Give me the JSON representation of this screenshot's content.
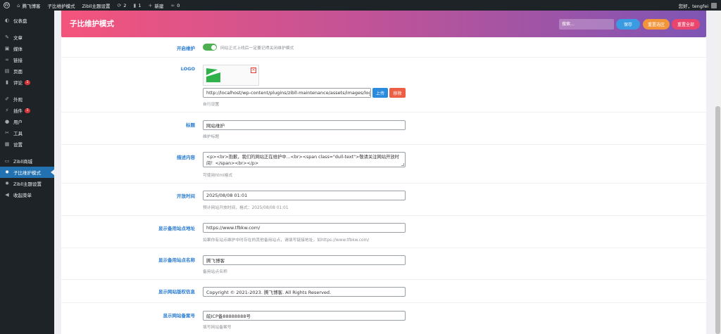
{
  "adminbar": {
    "site_name": "腾飞博客",
    "links": [
      "子比维护模式",
      "Zibll主题设置"
    ],
    "updates_count": "2",
    "comments_count": "1",
    "new_label": "新建",
    "links_count": "0",
    "greeting": "您好，tengfei"
  },
  "sidebar": {
    "items": [
      {
        "label": "仪表盘",
        "icon": "dashboard-icon"
      },
      {
        "label": "文章",
        "icon": "pin-icon"
      },
      {
        "label": "媒体",
        "icon": "media-icon"
      },
      {
        "label": "链接",
        "icon": "link-icon"
      },
      {
        "label": "页面",
        "icon": "page-icon"
      },
      {
        "label": "评论",
        "icon": "comment-icon",
        "badge": "1"
      },
      {
        "label": "外观",
        "icon": "brush-icon"
      },
      {
        "label": "插件",
        "icon": "plugin-icon",
        "badge": "1"
      },
      {
        "label": "用户",
        "icon": "user-icon"
      },
      {
        "label": "工具",
        "icon": "wrench-icon"
      },
      {
        "label": "设置",
        "icon": "settings-icon"
      },
      {
        "label": "Zibll商城",
        "icon": "shop-icon"
      },
      {
        "label": "子比维护模式",
        "icon": "gear-icon"
      },
      {
        "label": "Zibll主题设置",
        "icon": "gear-icon"
      },
      {
        "label": "收起菜单",
        "icon": "collapse-icon"
      }
    ]
  },
  "header": {
    "title": "子比维护模式",
    "search_placeholder": "搜索...",
    "save_label": "保存",
    "reset_section_label": "重置选区",
    "reset_all_label": "重置全部"
  },
  "form": {
    "maintenance": {
      "label": "开启维护",
      "desc": "网站正式上线后一定要记得关闭维护模式"
    },
    "logo": {
      "label": "LOGO",
      "url": "http://localhost/wp-content/plugins/zibll-maintenance/assets/images/logo/lo",
      "upload_label": "上传",
      "remove_label": "移除",
      "desc": "自行设置"
    },
    "title": {
      "label": "标题",
      "value": "网站维护",
      "desc": "维护标题"
    },
    "content": {
      "label": "描述内容",
      "value": "<p><br>抱歉，我们的网站正在维护中...<br><span class=\"dull-text\">敬请关注网站开放时间！</span><br></p>",
      "desc": "可使用html格式"
    },
    "open_time": {
      "label": "开放时间",
      "value": "2025/08/08 01:01",
      "desc": "预计网站开放时间，格式：2025/08/08 01:01"
    },
    "backup_url": {
      "label": "显示备用站点地址",
      "value": "https://www.tfbkw.com/",
      "desc": "如果你有站点维护中时存在的其他备用站点，请填写链接地址，如https://www.tfbkw.com/"
    },
    "backup_name": {
      "label": "显示备用站点名称",
      "value": "腾飞博客",
      "desc": "备用站点名称"
    },
    "copyright": {
      "label": "显示网站版权信息",
      "value": "Copyright © 2021-2023. 腾飞博客. All Rights Reserved."
    },
    "icp": {
      "label": "显示网站备案号",
      "value": "皖ICP备88888888号",
      "desc": "填写网站备案号"
    }
  },
  "colors": {
    "header_gradient_start": "#f4547c",
    "header_gradient_end": "#7e55b4",
    "accent": "#2271b1",
    "label": "#2a7cd1",
    "toggle_on": "#4caf50"
  }
}
